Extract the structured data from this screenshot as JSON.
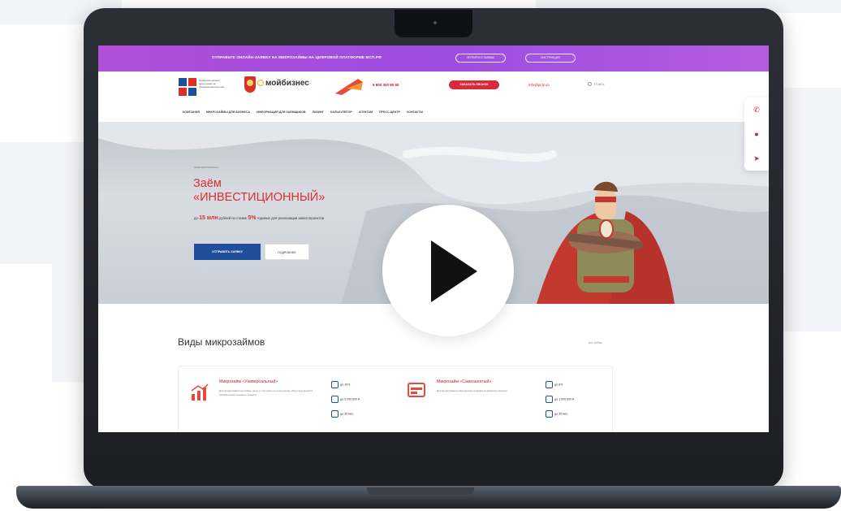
{
  "topbar": {
    "text": "ОТПРАВЬТЕ ОНЛАЙН-ЗАЯВКУ НА МИКРОЗАЙМЫ НА ЦИФРОВОЙ ПЛАТФОРМЕ МСП.РФ",
    "button_primary": "ПЕРЕЙТИ К ЗАЯВКЕ",
    "button_secondary": "ИНСТРУКЦИЯ"
  },
  "header": {
    "logo_text": "Пермский краевой фонд развития предпринимательства",
    "brand": "мойбизнес",
    "phone": "8 800 300 80 90",
    "callback_label": "ЗАКАЗАТЬ ЗВОНОК",
    "email": "info@pcrp.ru",
    "search_placeholder": "Поиск"
  },
  "nav": {
    "items": [
      "КОМПАНИЯ",
      "МИКРОЗАЙМЫ ДЛЯ БИЗНЕСА",
      "ИНФОРМАЦИЯ ДЛЯ ЗАЕМЩИКОВ",
      "ЛИЗИНГ",
      "КАЛЬКУЛЯТОР",
      "АГЕНТАМ",
      "ПРЕСС-ЦЕНТР",
      "КОНТАКТЫ"
    ]
  },
  "hero": {
    "kicker": "ЗАЕМ ДЛЯ БИЗНЕСА",
    "title_line1": "Заём",
    "title_line2": "«ИНВЕСТИЦИОННЫЙ»",
    "sub_prefix": "до",
    "sub_amount": "15 млн",
    "sub_mid": "рублей по ставке",
    "sub_rate": "5%",
    "sub_suffix": "годовых для реализации инвестпроектов",
    "button_primary": "ОТПРАВИТЬ ЗАЯВКУ",
    "button_secondary": "ПОДРОБНЕЕ"
  },
  "side_widget": [
    "✆",
    "●",
    "➤"
  ],
  "section": {
    "title": "Виды микрозаймов",
    "all_link": "все займы"
  },
  "cards": [
    {
      "title": "Микрозайм «Универсальный»",
      "desc": "Для кредитования на любые цели, в том числе на пополнение оборотных средств, приобретение основных средств",
      "stats": [
        "до 10%",
        "до 5 000 000 ₽",
        "до 36 мес."
      ]
    },
    {
      "title": "Микрозайм «Самозанятый»",
      "desc": "Для кредитования самозанятых граждан на развитие бизнеса",
      "stats": [
        "до 8%",
        "до 1 000 000 ₽",
        "до 36 мес."
      ]
    }
  ],
  "colors": {
    "topbar": "#a64fdc",
    "accent_red": "#d9302c",
    "primary_blue": "#1f4e9b"
  }
}
